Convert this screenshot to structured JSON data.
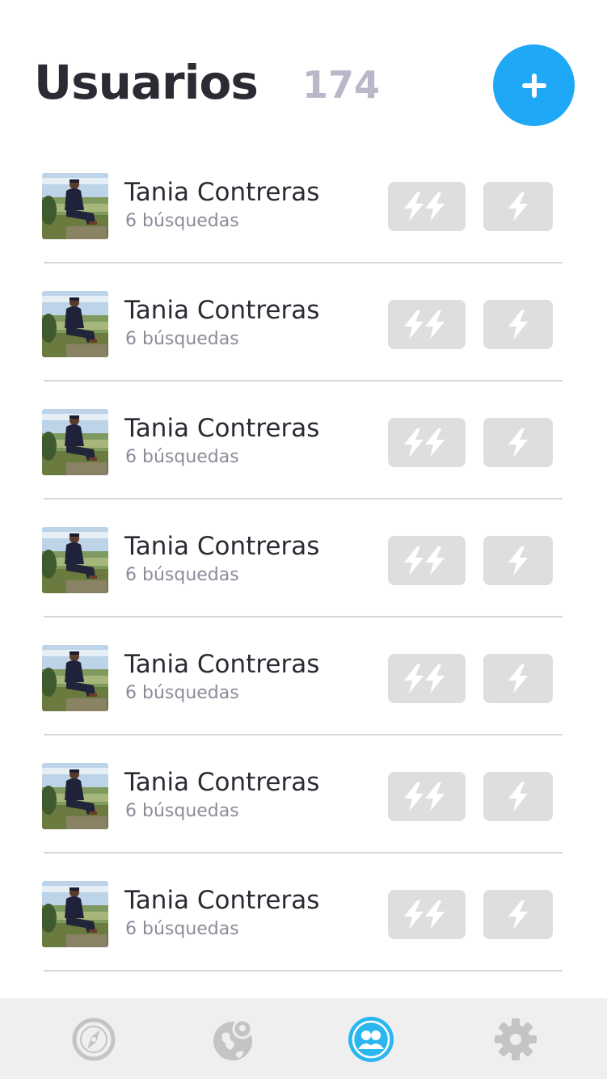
{
  "header": {
    "title": "Usuarios",
    "count": "174",
    "add_button_icon": "plus-icon"
  },
  "users": [
    {
      "name": "Tania Contreras",
      "searches": "6 búsquedas"
    },
    {
      "name": "Tania Contreras",
      "searches": "6 búsquedas"
    },
    {
      "name": "Tania Contreras",
      "searches": "6 búsquedas"
    },
    {
      "name": "Tania Contreras",
      "searches": "6 búsquedas"
    },
    {
      "name": "Tania Contreras",
      "searches": "6 búsquedas"
    },
    {
      "name": "Tania Contreras",
      "searches": "6 búsquedas"
    },
    {
      "name": "Tania Contreras",
      "searches": "6 búsquedas"
    }
  ],
  "row_actions": {
    "double_icon": "double-bolt-icon",
    "single_icon": "bolt-icon"
  },
  "bottom_nav": {
    "items": [
      {
        "icon": "compass-icon",
        "active": false
      },
      {
        "icon": "map-pin-globe-icon",
        "active": false
      },
      {
        "icon": "users-icon",
        "active": true
      },
      {
        "icon": "gear-icon",
        "active": false
      }
    ]
  },
  "colors": {
    "accent": "#1fa8f5",
    "nav_active": "#2bb6f0",
    "title": "#2a2b33",
    "count": "#b8b8c8",
    "subtext": "#8c8c99",
    "action_bg": "#dedede",
    "icon_inactive": "#c4c4c4",
    "nav_bg": "#efefef"
  }
}
